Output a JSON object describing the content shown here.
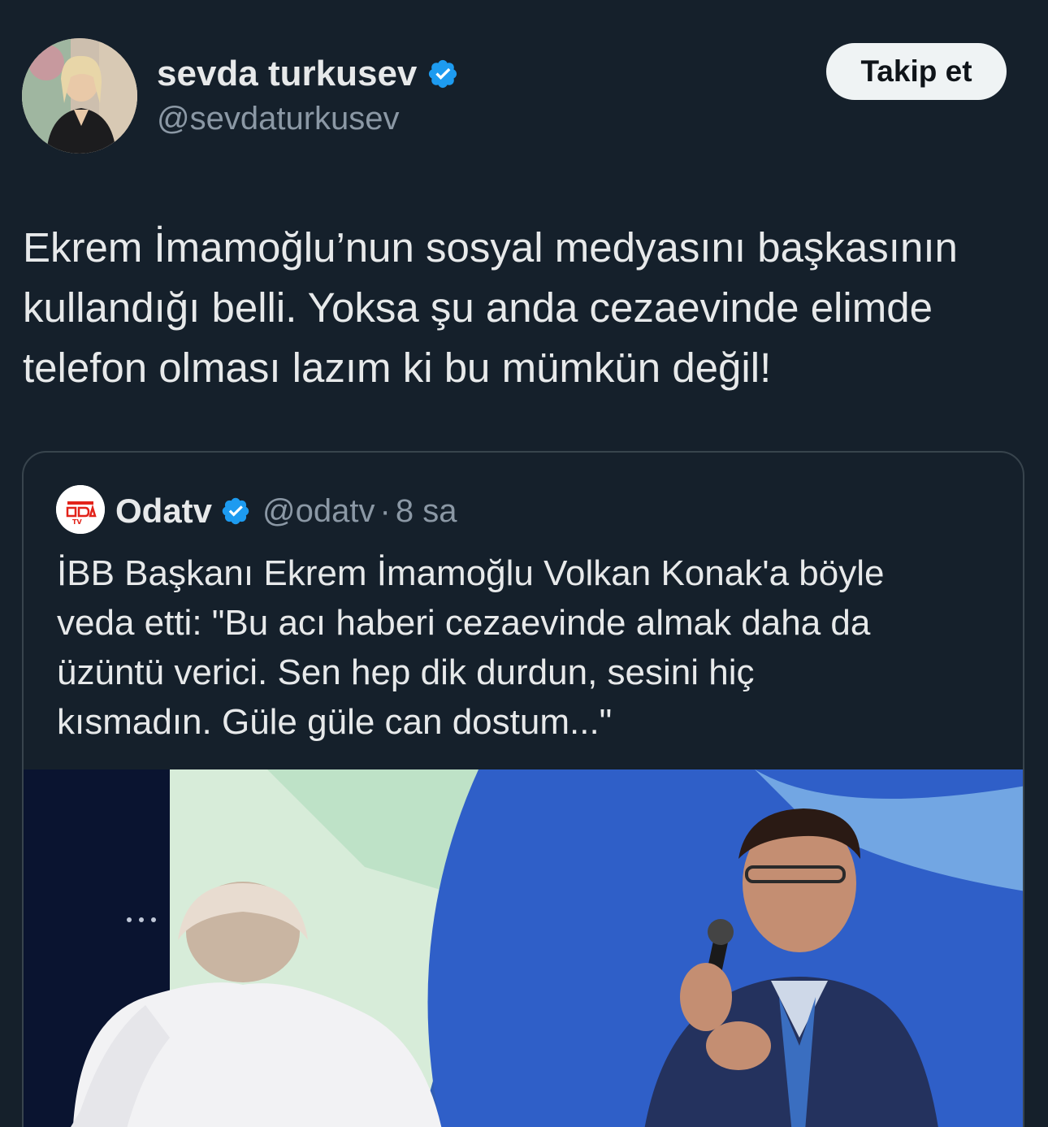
{
  "author": {
    "name": "sevda turkusev",
    "handle": "@sevdaturkusev",
    "verified": true
  },
  "follow_button": {
    "label": "Takip et"
  },
  "tweet": {
    "lines": [
      "Ekrem İmamoğlu’nun sosyal medyasını başkasının",
      "kullandığı belli. Yoksa şu anda cezaevinde elimde",
      "telefon olması lazım ki bu mümkün değil!"
    ]
  },
  "quote": {
    "name": "Odatv",
    "handle": "@odatv",
    "separator": "·",
    "time": "8 sa",
    "verified": true,
    "lines": [
      "İBB Başkanı Ekrem İmamoğlu Volkan Konak'a böyle",
      "veda etti: \"Bu acı haberi cezaevinde almak daha da",
      "üzüntü verici. Sen hep dik durdun, sesini hiç",
      "kısmadın. Güle güle can dostum...\""
    ],
    "media": {
      "description_icon": "photo-icon"
    }
  },
  "colors": {
    "background": "#15202b",
    "text": "#e7e9ea",
    "secondary_text": "#8b98a5",
    "border": "#38444d",
    "verified": "#1d9bf0",
    "button_bg": "#eff3f4"
  }
}
